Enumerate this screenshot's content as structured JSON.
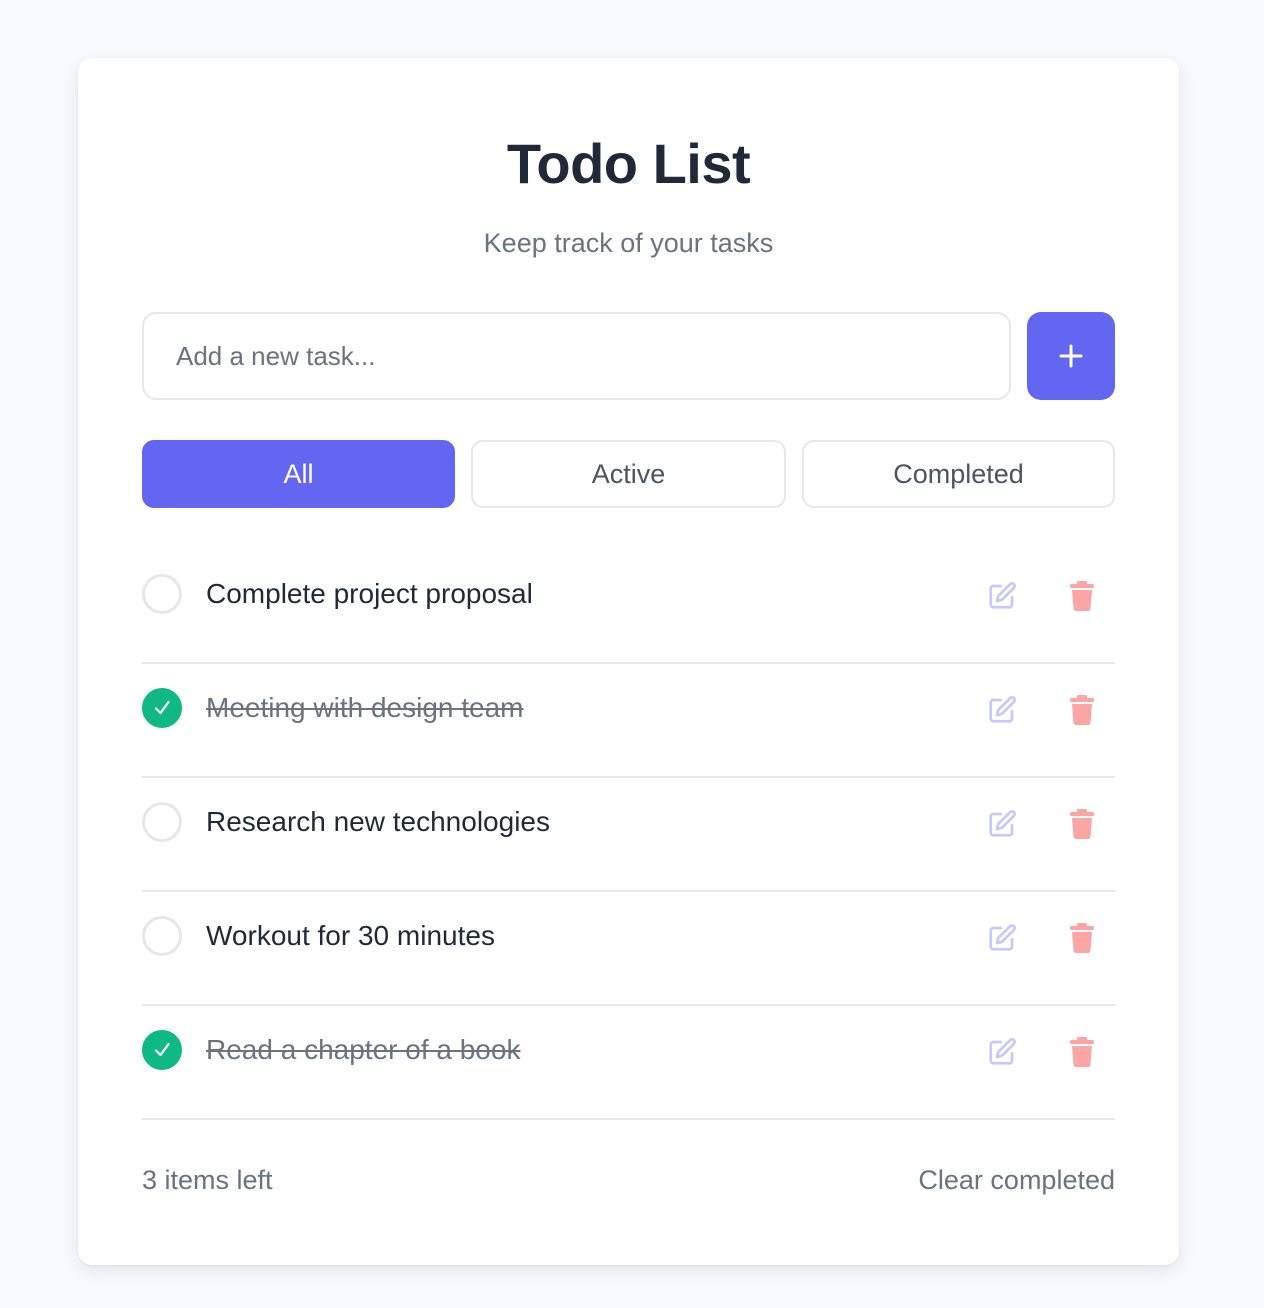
{
  "header": {
    "title": "Todo List",
    "subtitle": "Keep track of your tasks"
  },
  "new_task": {
    "placeholder": "Add a new task...",
    "value": "",
    "add_icon": "plus-icon"
  },
  "filters": [
    {
      "label": "All",
      "active": true
    },
    {
      "label": "Active",
      "active": false
    },
    {
      "label": "Completed",
      "active": false
    }
  ],
  "todos": [
    {
      "text": "Complete project proposal",
      "completed": false
    },
    {
      "text": "Meeting with design team",
      "completed": true
    },
    {
      "text": "Research new technologies",
      "completed": false
    },
    {
      "text": "Workout for 30 minutes",
      "completed": false
    },
    {
      "text": "Read a chapter of a book",
      "completed": true
    }
  ],
  "icons": {
    "edit": "edit-icon",
    "delete": "trash-icon",
    "check": "check-icon"
  },
  "footer": {
    "items_left": "3 items left",
    "clear_label": "Clear completed"
  },
  "colors": {
    "accent": "#6366f1",
    "completed": "#10b981",
    "edit_icon": "#c7c9fa",
    "delete_icon": "#fca5a5",
    "title": "#1f2937",
    "muted": "#6b7280"
  }
}
